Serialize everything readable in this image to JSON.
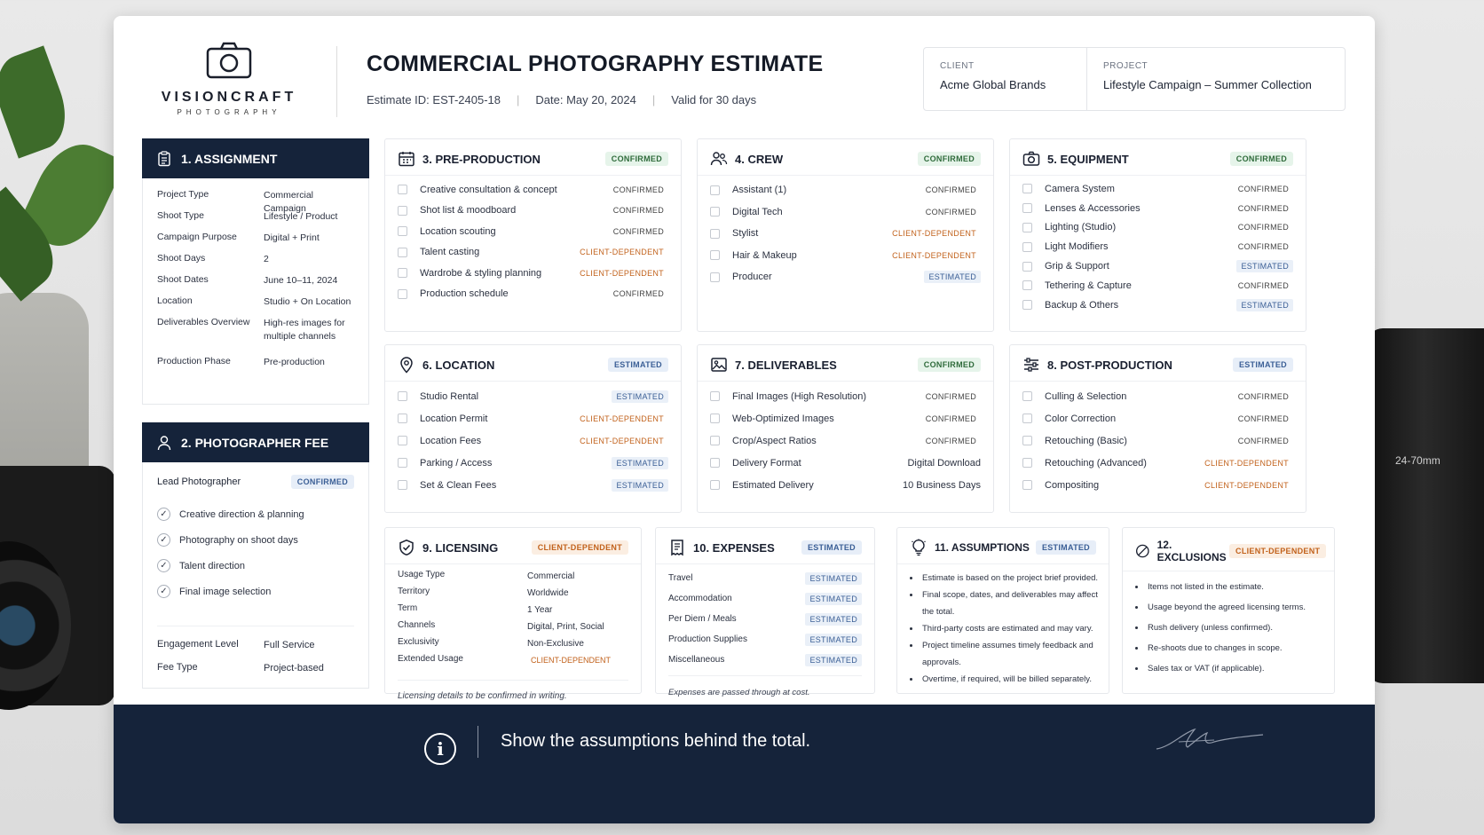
{
  "brand": {
    "name": "VISIONCRAFT",
    "sub": "PHOTOGRAPHY"
  },
  "header": {
    "title": "COMMERCIAL PHOTOGRAPHY ESTIMATE",
    "estimate_id": "Estimate ID: EST-2405-18",
    "date": "Date: May 20, 2024",
    "valid": "Valid for 30 days",
    "client_label": "CLIENT",
    "client_value": "Acme Global Brands",
    "project_label": "PROJECT",
    "project_value": "Lifestyle Campaign – Summer Collection"
  },
  "assignment": {
    "title": "1. ASSIGNMENT",
    "rows": [
      {
        "k": "Project Type",
        "v": "Commercial Campaign"
      },
      {
        "k": "Shoot Type",
        "v": "Lifestyle / Product"
      },
      {
        "k": "Campaign Purpose",
        "v": "Digital + Print"
      },
      {
        "k": "Shoot Days",
        "v": "2"
      },
      {
        "k": "Shoot Dates",
        "v": "June 10–11, 2024"
      },
      {
        "k": "Location",
        "v": "Studio + On Location"
      },
      {
        "k": "Deliverables Overview",
        "v": "High-res images for multiple channels"
      },
      {
        "k": "Production Phase",
        "v": "Pre-production"
      }
    ]
  },
  "fee": {
    "title": "2. PHOTOGRAPHER FEE",
    "lead_label": "Lead Photographer",
    "lead_status": "CONFIRMED",
    "items": [
      "Creative direction & planning",
      "Photography on shoot days",
      "Talent direction",
      "Final image selection"
    ],
    "engagement_label": "Engagement Level",
    "engagement_value": "Full Service",
    "fee_type_label": "Fee Type",
    "fee_type_value": "Project-based"
  },
  "preproduction": {
    "title": "3. PRE-PRODUCTION",
    "status": "CONFIRMED",
    "items": [
      {
        "label": "Creative consultation & concept",
        "status": "CONFIRMED"
      },
      {
        "label": "Shot list & moodboard",
        "status": "CONFIRMED"
      },
      {
        "label": "Location scouting",
        "status": "CONFIRMED"
      },
      {
        "label": "Talent casting",
        "status": "CLIENT-DEPENDENT"
      },
      {
        "label": "Wardrobe & styling planning",
        "status": "CLIENT-DEPENDENT"
      },
      {
        "label": "Production schedule",
        "status": "CONFIRMED"
      }
    ]
  },
  "crew": {
    "title": "4. CREW",
    "status": "CONFIRMED",
    "items": [
      {
        "label": "Assistant (1)",
        "status": "CONFIRMED"
      },
      {
        "label": "Digital Tech",
        "status": "CONFIRMED"
      },
      {
        "label": "Stylist",
        "status": "CLIENT-DEPENDENT"
      },
      {
        "label": "Hair & Makeup",
        "status": "CLIENT-DEPENDENT"
      },
      {
        "label": "Producer",
        "status": "ESTIMATED"
      }
    ]
  },
  "equipment": {
    "title": "5. EQUIPMENT",
    "status": "CONFIRMED",
    "items": [
      {
        "label": "Camera System",
        "status": "CONFIRMED"
      },
      {
        "label": "Lenses & Accessories",
        "status": "CONFIRMED"
      },
      {
        "label": "Lighting (Studio)",
        "status": "CONFIRMED"
      },
      {
        "label": "Light Modifiers",
        "status": "CONFIRMED"
      },
      {
        "label": "Grip & Support",
        "status": "ESTIMATED"
      },
      {
        "label": "Tethering & Capture",
        "status": "CONFIRMED"
      },
      {
        "label": "Backup & Others",
        "status": "ESTIMATED"
      }
    ]
  },
  "location": {
    "title": "6. LOCATION",
    "status": "ESTIMATED",
    "items": [
      {
        "label": "Studio Rental",
        "status": "ESTIMATED"
      },
      {
        "label": "Location Permit",
        "status": "CLIENT-DEPENDENT"
      },
      {
        "label": "Location Fees",
        "status": "CLIENT-DEPENDENT"
      },
      {
        "label": "Parking / Access",
        "status": "ESTIMATED"
      },
      {
        "label": "Set & Clean Fees",
        "status": "ESTIMATED"
      }
    ]
  },
  "deliverables": {
    "title": "7. DELIVERABLES",
    "status": "CONFIRMED",
    "items": [
      {
        "label": "Final Images (High Resolution)",
        "value": "CONFIRMED"
      },
      {
        "label": "Web-Optimized Images",
        "value": "CONFIRMED"
      },
      {
        "label": "Crop/Aspect Ratios",
        "value": "CONFIRMED"
      },
      {
        "label": "Delivery Format",
        "value": "Digital Download"
      },
      {
        "label": "Estimated Delivery",
        "value": "10 Business Days"
      }
    ]
  },
  "postproduction": {
    "title": "8. POST-PRODUCTION",
    "status": "ESTIMATED",
    "items": [
      {
        "label": "Culling & Selection",
        "status": "CONFIRMED"
      },
      {
        "label": "Color Correction",
        "status": "CONFIRMED"
      },
      {
        "label": "Retouching (Basic)",
        "status": "CONFIRMED"
      },
      {
        "label": "Retouching (Advanced)",
        "status": "CLIENT-DEPENDENT"
      },
      {
        "label": "Compositing",
        "status": "CLIENT-DEPENDENT"
      }
    ]
  },
  "licensing": {
    "title": "9. LICENSING",
    "status": "CLIENT-DEPENDENT",
    "rows": [
      {
        "k": "Usage Type",
        "v": "Commercial"
      },
      {
        "k": "Territory",
        "v": "Worldwide"
      },
      {
        "k": "Term",
        "v": "1 Year"
      },
      {
        "k": "Channels",
        "v": "Digital, Print, Social"
      },
      {
        "k": "Exclusivity",
        "v": "Non-Exclusive"
      },
      {
        "k": "Extended Usage",
        "v": "CLIENT-DEPENDENT"
      }
    ],
    "note": "Licensing details to be confirmed in writing."
  },
  "expenses": {
    "title": "10. EXPENSES",
    "status": "ESTIMATED",
    "items": [
      {
        "label": "Travel",
        "status": "ESTIMATED"
      },
      {
        "label": "Accommodation",
        "status": "ESTIMATED"
      },
      {
        "label": "Per Diem / Meals",
        "status": "ESTIMATED"
      },
      {
        "label": "Production Supplies",
        "status": "ESTIMATED"
      },
      {
        "label": "Miscellaneous",
        "status": "ESTIMATED"
      }
    ],
    "note": "Expenses are passed through at cost."
  },
  "assumptions": {
    "title": "11. ASSUMPTIONS",
    "status": "ESTIMATED",
    "items": [
      "Estimate is based on the project brief provided.",
      "Final scope, dates, and deliverables may affect the total.",
      "Third-party costs are estimated and may vary.",
      "Project timeline assumes timely feedback and approvals.",
      "Overtime, if required, will be billed separately."
    ]
  },
  "exclusions": {
    "title": "12. EXCLUSIONS",
    "status": "CLIENT-DEPENDENT",
    "items": [
      "Items not listed in the estimate.",
      "Usage beyond the agreed licensing terms.",
      "Rush delivery (unless confirmed).",
      "Re-shoots due to changes in scope.",
      "Sales tax or VAT (if applicable)."
    ]
  },
  "footer": {
    "text": "Show the assumptions behind the total."
  },
  "decor": {
    "lens_label": "24-70mm"
  },
  "colors": {
    "navy": "#15233a",
    "confirmed": "#2f6b3b",
    "estimated": "#3b5f96",
    "client_dependent": "#c2621c"
  }
}
